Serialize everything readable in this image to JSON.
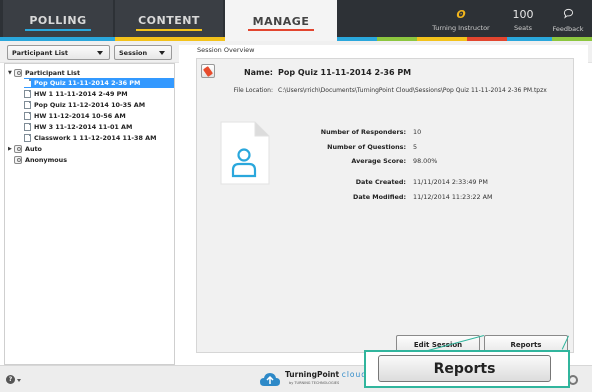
{
  "nav": {
    "tabs": [
      {
        "label": "POLLING",
        "accent": "#2aa7dc"
      },
      {
        "label": "CONTENT",
        "accent": "#f3c21b"
      },
      {
        "label": "MANAGE",
        "accent": "#e2452f",
        "active": true
      }
    ],
    "instructor": {
      "icon": "turning-logo-icon",
      "label": "Turning Instructor"
    },
    "seats": {
      "count": "100",
      "label": "Seats"
    },
    "feedback": {
      "icon": "feedback-icon",
      "label": "Feedback"
    }
  },
  "toolbar": {
    "participant_dropdown": "Participant List",
    "session_dropdown": "Session"
  },
  "tree": {
    "groups": [
      {
        "label": "Participant List",
        "expanded": true,
        "items": [
          {
            "label": "Pop Quiz 11-11-2014 2-36 PM",
            "selected": true
          },
          {
            "label": "HW 1 11-11-2014 2-49 PM"
          },
          {
            "label": "Pop Quiz 11-12-2014 10-35 AM"
          },
          {
            "label": "HW 11-12-2014 10-56 AM"
          },
          {
            "label": "HW 3 11-12-2014 11-01 AM"
          },
          {
            "label": "Classwork 1 11-12-2014 11-38 AM"
          }
        ]
      },
      {
        "label": "Auto",
        "expanded": false
      },
      {
        "label": "Anonymous"
      }
    ]
  },
  "overview": {
    "heading": "Session Overview",
    "name_label": "Name:",
    "name_value": "Pop Quiz 11-11-2014 2-36 PM",
    "location_label": "File Location:",
    "location_value": "C:\\Users\\rrich\\Documents\\TurningPoint Cloud\\Sessions\\Pop Quiz 11-11-2014 2-36 PM.tpzx",
    "stats": [
      {
        "label": "Number of Responders:",
        "value": "10"
      },
      {
        "label": "Number of Questions:",
        "value": "5"
      },
      {
        "label": "Average Score:",
        "value": "98.00%"
      },
      {
        "label": "Date Created:",
        "value": "11/11/2014 2:33:49 PM"
      },
      {
        "label": "Date Modified:",
        "value": "11/12/2014 11:23:22 AM"
      }
    ]
  },
  "buttons": {
    "edit_session": "Edit Session",
    "reports": "Reports",
    "reports_callout": "Reports"
  },
  "footer": {
    "brand_main": "TurningPoint",
    "brand_cloud": "cloud",
    "brand_sub": "by TURNING TECHNOLOGIES"
  },
  "colors": {
    "callout": "#31b59d",
    "selection": "#3399ff",
    "topbar": "#2d3136"
  }
}
